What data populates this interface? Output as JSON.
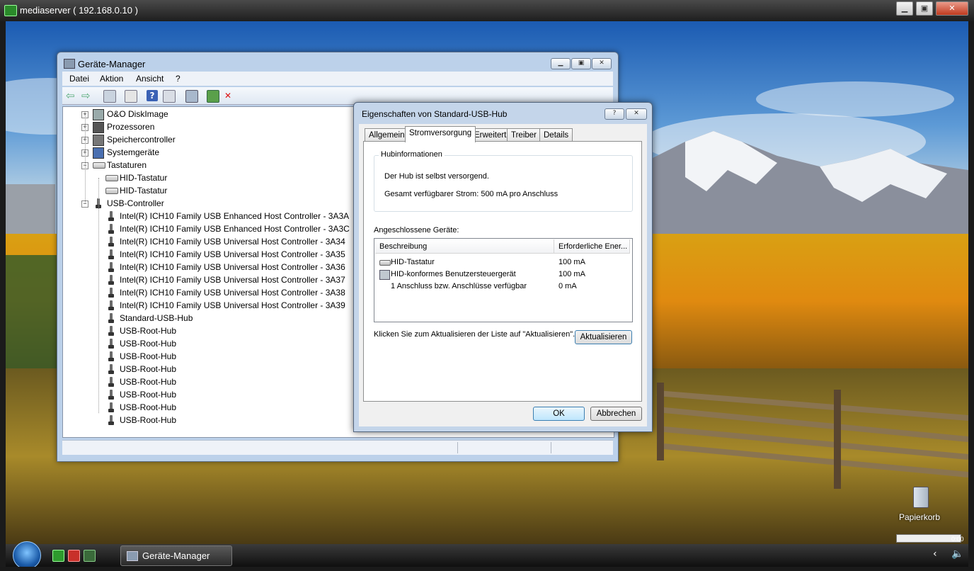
{
  "rdp": {
    "title": "mediaserver ( 192.168.0.10 )"
  },
  "devmgr": {
    "title": "Geräte-Manager",
    "menu": [
      "Datei",
      "Aktion",
      "Ansicht",
      "?"
    ],
    "tree": [
      {
        "label": "O&O DiskImage",
        "expander": "+",
        "icon": "disk-icon"
      },
      {
        "label": "Prozessoren",
        "expander": "+",
        "icon": "cpu-icon"
      },
      {
        "label": "Speichercontroller",
        "expander": "+",
        "icon": "storage-icon"
      },
      {
        "label": "Systemgeräte",
        "expander": "+",
        "icon": "system-icon"
      },
      {
        "label": "Tastaturen",
        "expander": "−",
        "icon": "keyboard-icon"
      },
      {
        "label": "HID-Tastatur",
        "child": true,
        "icon": "keyboard-icon"
      },
      {
        "label": "HID-Tastatur",
        "child": true,
        "icon": "keyboard-icon"
      },
      {
        "label": "USB-Controller",
        "expander": "−",
        "icon": "usb-icon"
      },
      {
        "label": "Intel(R) ICH10 Family USB Enhanced Host Controller - 3A3A",
        "child": true,
        "icon": "usb-icon"
      },
      {
        "label": "Intel(R) ICH10 Family USB Enhanced Host Controller - 3A3C",
        "child": true,
        "icon": "usb-icon"
      },
      {
        "label": "Intel(R) ICH10 Family USB Universal Host Controller - 3A34",
        "child": true,
        "icon": "usb-icon"
      },
      {
        "label": "Intel(R) ICH10 Family USB Universal Host Controller - 3A35",
        "child": true,
        "icon": "usb-icon"
      },
      {
        "label": "Intel(R) ICH10 Family USB Universal Host Controller - 3A36",
        "child": true,
        "icon": "usb-icon"
      },
      {
        "label": "Intel(R) ICH10 Family USB Universal Host Controller - 3A37",
        "child": true,
        "icon": "usb-icon"
      },
      {
        "label": "Intel(R) ICH10 Family USB Universal Host Controller - 3A38",
        "child": true,
        "icon": "usb-icon"
      },
      {
        "label": "Intel(R) ICH10 Family USB Universal Host Controller - 3A39",
        "child": true,
        "icon": "usb-icon"
      },
      {
        "label": "Standard-USB-Hub",
        "child": true,
        "icon": "usb-icon"
      },
      {
        "label": "USB-Root-Hub",
        "child": true,
        "icon": "usb-icon"
      },
      {
        "label": "USB-Root-Hub",
        "child": true,
        "icon": "usb-icon"
      },
      {
        "label": "USB-Root-Hub",
        "child": true,
        "icon": "usb-icon"
      },
      {
        "label": "USB-Root-Hub",
        "child": true,
        "icon": "usb-icon"
      },
      {
        "label": "USB-Root-Hub",
        "child": true,
        "icon": "usb-icon"
      },
      {
        "label": "USB-Root-Hub",
        "child": true,
        "icon": "usb-icon"
      },
      {
        "label": "USB-Root-Hub",
        "child": true,
        "icon": "usb-icon"
      },
      {
        "label": "USB-Root-Hub",
        "child": true,
        "icon": "usb-icon"
      }
    ]
  },
  "props": {
    "title": "Eigenschaften von Standard-USB-Hub",
    "help_btn": "?",
    "close_btn": "✕",
    "tabs": [
      "Allgemein",
      "Stromversorgung",
      "Erweitert",
      "Treiber",
      "Details"
    ],
    "active_tab": "Stromversorgung",
    "hub_group": "Hubinformationen",
    "hub_self_powered": "Der Hub ist selbst versorgend.",
    "hub_power": "Gesamt verfügbarer Strom: 500 mA pro Anschluss",
    "connected_label": "Angeschlossene Geräte:",
    "columns": [
      "Beschreibung",
      "Erforderliche Ener..."
    ],
    "rows": [
      {
        "desc": "HID-Tastatur",
        "power": "100 mA",
        "icon": "keyboard-icon"
      },
      {
        "desc": "HID-konformes Benutzersteuergerät",
        "power": "100 mA",
        "icon": "hid-device-icon"
      },
      {
        "desc": "1 Anschluss bzw. Anschlüsse verfügbar",
        "power": "0 mA",
        "icon": ""
      }
    ],
    "refresh_hint": "Klicken Sie zum Aktualisieren der Liste auf \"Aktualisieren\".",
    "refresh_btn": "Aktualisieren",
    "ok_btn": "OK",
    "cancel_btn": "Abbrechen"
  },
  "desktop": {
    "recycle_bin": "Papierkorb",
    "clock": "0:00"
  },
  "taskbar": {
    "task": "Geräte-Manager"
  }
}
